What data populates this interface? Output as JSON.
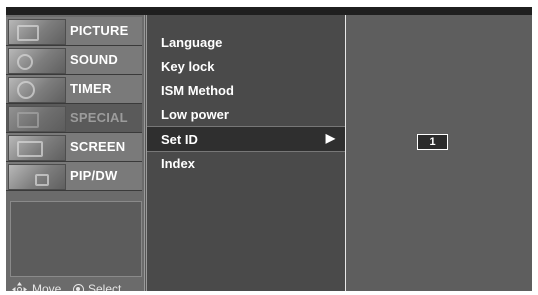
{
  "sidebar": {
    "items": [
      {
        "label": "PICTURE",
        "active": false
      },
      {
        "label": "SOUND",
        "active": false
      },
      {
        "label": "TIMER",
        "active": false
      },
      {
        "label": "SPECIAL",
        "active": true
      },
      {
        "label": "SCREEN",
        "active": false
      },
      {
        "label": "PIP/DW",
        "active": false
      }
    ],
    "hint": {
      "move": "Move",
      "select": "Select"
    }
  },
  "menu": {
    "items": [
      {
        "label": "Language"
      },
      {
        "label": "Key lock"
      },
      {
        "label": "ISM Method"
      },
      {
        "label": "Low power"
      },
      {
        "label": "Set ID",
        "selected": true,
        "arrow": "▶"
      },
      {
        "label": "Index"
      }
    ]
  },
  "panel": {
    "set_id_value": "1"
  },
  "colors": {
    "background": "#565656",
    "highlight": "#2f2f2f",
    "text": "#ffffff",
    "inactive_text": "#9c9c9c"
  }
}
